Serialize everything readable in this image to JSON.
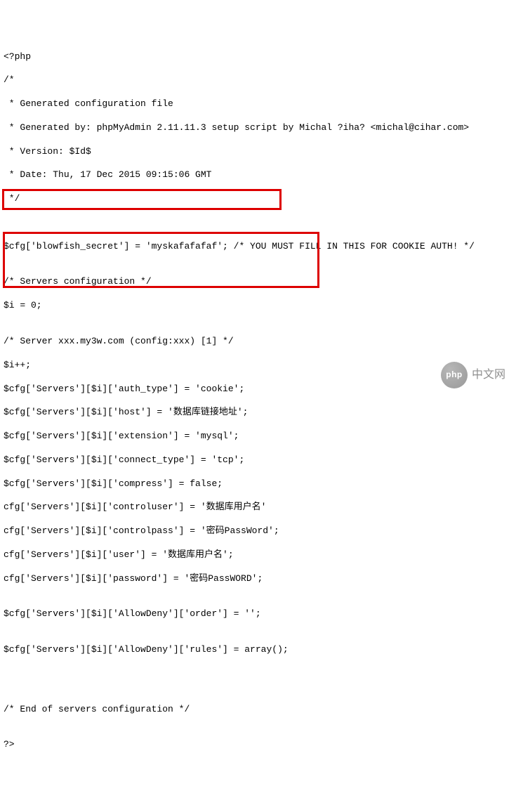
{
  "lines": {
    "l00": "<?php",
    "l01": "/*",
    "l02": " * Generated configuration file",
    "l03": " * Generated by: phpMyAdmin 2.11.11.3 setup script by Michal ?iha? <michal@cihar.com>",
    "l04": " * Version: $Id$",
    "l05": " * Date: Thu, 17 Dec 2015 09:15:06 GMT",
    "l06": " */",
    "l07": "",
    "l08": "",
    "l09": "$cfg['blowfish_secret'] = 'myskafafafaf'; /* YOU MUST FILL IN THIS FOR COOKIE AUTH! */",
    "l10": "",
    "l11": "/* Servers configuration */",
    "l12": "$i = 0;",
    "l13": "",
    "l14": "/* Server xxx.my3w.com (config:xxx) [1] */",
    "l15": "$i++;",
    "l16": "$cfg['Servers'][$i]['auth_type'] = 'cookie';",
    "l17": "$cfg['Servers'][$i]['host'] = '数据库链接地址';",
    "l18": "$cfg['Servers'][$i]['extension'] = 'mysql';",
    "l19": "$cfg['Servers'][$i]['connect_type'] = 'tcp';",
    "l20": "$cfg['Servers'][$i]['compress'] = false;",
    "l21": "cfg['Servers'][$i]['controluser'] = '数据库用户名'",
    "l22": "cfg['Servers'][$i]['controlpass'] = '密码PassWord';",
    "l23": "cfg['Servers'][$i]['user'] = '数据库用户名';",
    "l24": "cfg['Servers'][$i]['password'] = '密码PassWORD';",
    "l25": "",
    "l26": "$cfg['Servers'][$i]['AllowDeny']['order'] = '';",
    "l27": "",
    "l28": "$cfg['Servers'][$i]['AllowDeny']['rules'] = array();",
    "l29": "",
    "l30": "",
    "l31": "",
    "l32": "/* End of servers configuration */",
    "l33": "",
    "l34": "?>"
  },
  "logo": {
    "badge": "php",
    "text": "中文网"
  }
}
